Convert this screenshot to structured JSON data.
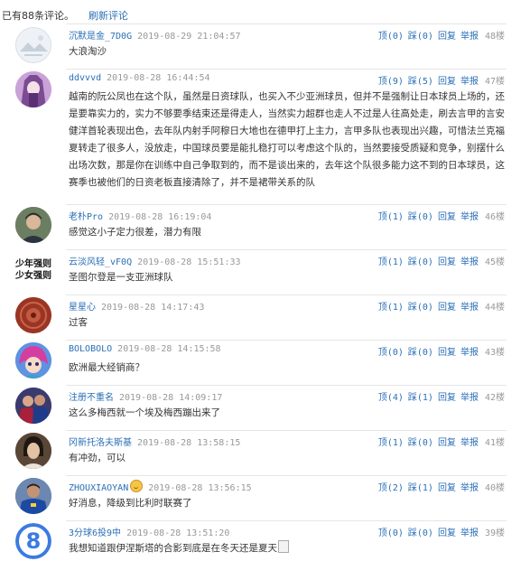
{
  "header": {
    "count_text": "已有88条评论。",
    "refresh_label": "刷新评论"
  },
  "comments": [
    {
      "user": "沉默是金_7D0G",
      "time": "2019-08-29 21:04:57",
      "up": "顶(0)",
      "down": "踩(0)",
      "reply": "回复",
      "report": "举报",
      "floor": "48楼",
      "text": "大浪淘沙",
      "avatar": "avatar-landscape-icon"
    },
    {
      "user": "ddvvvd",
      "time": "2019-08-28 16:44:54",
      "up": "顶(9)",
      "down": "踩(5)",
      "reply": "回复",
      "report": "举报",
      "floor": "47楼",
      "text": "越南的阮公凤也在这个队，虽然是日资球队，也买入不少亚洲球员，但并不是强制让日本球员上场的，还是要靠实力的，实力不够要季结束还是得走人，当然实力超群也走人不过是人往高处走，刷去言甲的言安健洋首轮表现出色，去年队内射手阿穆日大地也在德甲打上主力，言甲多队也表现出兴趣，可惜法兰克福夏转走了很多人，没放走，中国球员要是能扎稳打可以考虑这个队的，当然要接受质疑和竞争，别摆什么出场次数，那是你在训练中自己争取到的，而不是谈出来的，去年这个队很多能力这不到的日本球员，这赛季也被他们的日资老板直接清除了，并不是裙带关系的队",
      "avatar": "avatar-anime-icon"
    },
    {
      "user": "老朴Pro",
      "time": "2019-08-28 16:19:04",
      "up": "顶(1)",
      "down": "踩(0)",
      "reply": "回复",
      "report": "举报",
      "floor": "46楼",
      "text": "感觉这小子定力很差，潜力有限",
      "avatar": "avatar-person-icon"
    },
    {
      "user": "云淡风轻_vF0Q",
      "time": "2019-08-28 15:51:33",
      "up": "顶(1)",
      "down": "踩(0)",
      "reply": "回复",
      "report": "举报",
      "floor": "45楼",
      "text": "圣图尔登是一支亚洲球队",
      "avatar": "avatar-text-icon",
      "avatar_line1": "少年强则",
      "avatar_line2": "少女强则"
    },
    {
      "user": "星星心",
      "time": "2019-08-28 14:17:43",
      "up": "顶(1)",
      "down": "踩(0)",
      "reply": "回复",
      "report": "举报",
      "floor": "44楼",
      "text": "过客",
      "avatar": "avatar-seal-icon"
    },
    {
      "user": "BOLOBOLO",
      "time": "2019-08-28 14:15:58",
      "up": "顶(0)",
      "down": "踩(0)",
      "reply": "回复",
      "report": "举报",
      "floor": "43楼",
      "text": "欧洲最大经销商？",
      "avatar": "avatar-cartoon-icon"
    },
    {
      "user": "注册不重名",
      "time": "2019-08-28 14:09:17",
      "up": "顶(4)",
      "down": "踩(1)",
      "reply": "回复",
      "report": "举报",
      "floor": "42楼",
      "text": "这么多梅西就一个埃及梅西蹦出来了",
      "avatar": "avatar-players-icon"
    },
    {
      "user": "冈新托洛夫斯基",
      "time": "2019-08-28 13:58:15",
      "up": "顶(1)",
      "down": "踩(0)",
      "reply": "回复",
      "report": "举报",
      "floor": "41楼",
      "text": "有冲劲，可以",
      "avatar": "avatar-portrait-icon"
    },
    {
      "user": "ZHOUXIAOYAN",
      "time": "2019-08-28 13:56:15",
      "up": "顶(2)",
      "down": "踩(1)",
      "reply": "回复",
      "report": "举报",
      "floor": "40楼",
      "text": "好消息，降级到比利时联赛了",
      "avatar": "avatar-footballer-icon"
    },
    {
      "user": "3分球6投9中",
      "time": "2019-08-28 13:51:20",
      "up": "顶(0)",
      "down": "踩(0)",
      "reply": "回复",
      "report": "举报",
      "floor": "39楼",
      "text": "我想知道跟伊涅斯塔的合影到底是在冬天还是夏天",
      "avatar": "avatar-number-icon",
      "avatar_glyph": "8"
    }
  ]
}
